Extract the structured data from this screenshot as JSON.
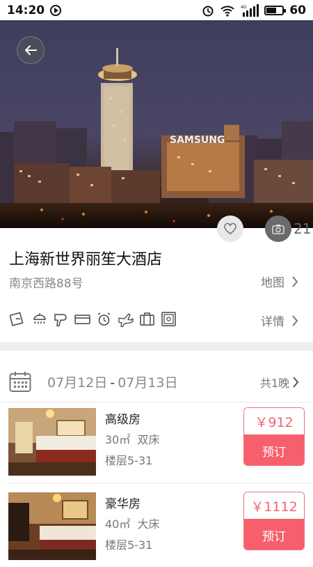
{
  "status_bar": {
    "time": "14:20",
    "battery": "60",
    "network": "4G"
  },
  "hotel": {
    "name": "上海新世界丽笙大酒店",
    "address": "南京西路88号",
    "map_label": "地图",
    "detail_label": "详情",
    "photo_count": "21",
    "hero_sign": "SAMSUNG"
  },
  "amenities": [
    "wifi-icon",
    "shower-icon",
    "hairdryer-icon",
    "card-icon",
    "alarm-icon",
    "airport-icon",
    "luggage-icon",
    "safe-icon"
  ],
  "stay": {
    "check_in": "07月12日",
    "separator": "-",
    "check_out": "07月13日",
    "nights_label": "共1晚"
  },
  "rooms": [
    {
      "name": "高级房",
      "area": "30㎡",
      "bed": "双床",
      "floor": "楼层5-31",
      "price": "￥912",
      "book_label": "预订"
    },
    {
      "name": "豪华房",
      "area": "40㎡",
      "bed": "大床",
      "floor": "楼层5-31",
      "price": "￥1112",
      "book_label": "预订"
    }
  ],
  "colors": {
    "accent": "#f65f6b",
    "price_text": "#f26570"
  }
}
